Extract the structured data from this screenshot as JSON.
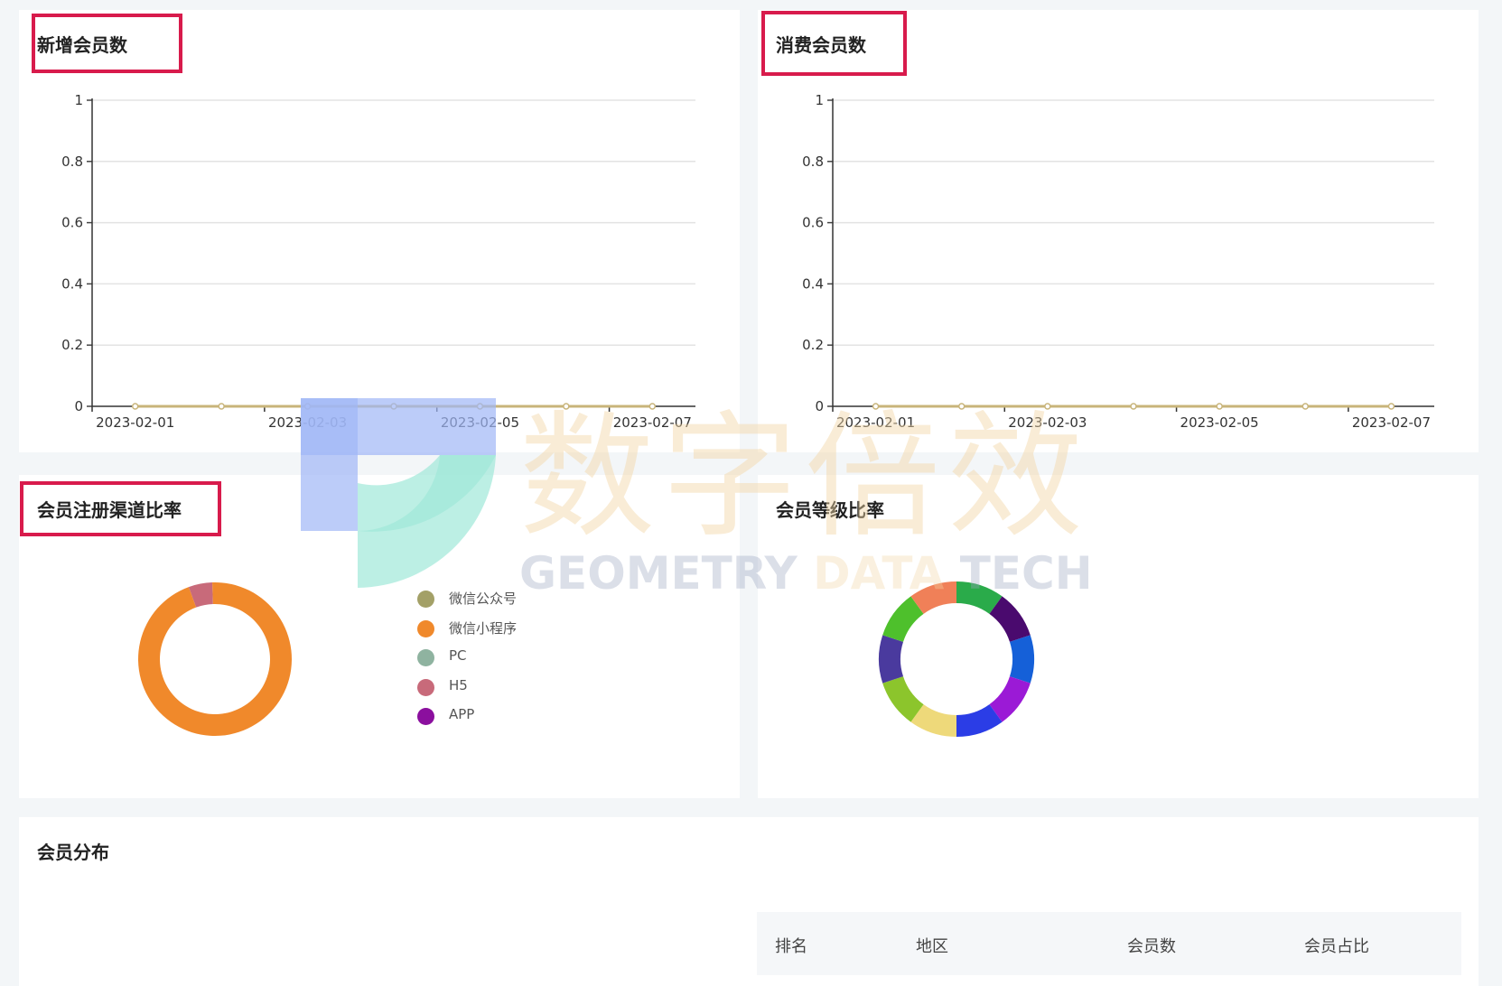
{
  "panels": {
    "new_members": {
      "title": "新增会员数"
    },
    "consume_members": {
      "title": "消费会员数"
    },
    "channel_ratio": {
      "title": "会员注册渠道比率"
    },
    "level_ratio": {
      "title": "会员等级比率"
    },
    "distribution": {
      "title": "会员分布"
    }
  },
  "table": {
    "headers": [
      "排名",
      "地区",
      "会员数",
      "会员占比"
    ]
  },
  "watermark": {
    "cn": "数字倍效",
    "en_a": "GEOMETRY ",
    "en_b": "DATA",
    "en_c": " TECH"
  },
  "chart_data": [
    {
      "type": "line",
      "x": [
        "2023-02-01",
        "2023-02-02",
        "2023-02-03",
        "2023-02-04",
        "2023-02-05",
        "2023-02-06",
        "2023-02-07"
      ],
      "x_tick_labels": [
        "2023-02-01",
        "2023-02-03",
        "2023-02-05",
        "2023-02-07"
      ],
      "series": [
        {
          "values": [
            0,
            0,
            0,
            0,
            0,
            0,
            0
          ],
          "color": "#c8b47a"
        }
      ],
      "ylim": [
        0,
        1
      ],
      "y_ticks": [
        "0",
        "0.2",
        "0.4",
        "0.6",
        "0.8",
        "1"
      ],
      "grid": true
    },
    {
      "type": "line",
      "x": [
        "2023-02-01",
        "2023-02-02",
        "2023-02-03",
        "2023-02-04",
        "2023-02-05",
        "2023-02-06",
        "2023-02-07"
      ],
      "x_tick_labels": [
        "2023-02-01",
        "2023-02-03",
        "2023-02-05",
        "2023-02-07"
      ],
      "series": [
        {
          "values": [
            0,
            0,
            0,
            0,
            0,
            0,
            0
          ],
          "color": "#c8b47a"
        }
      ],
      "ylim": [
        0,
        1
      ],
      "y_ticks": [
        "0",
        "0.2",
        "0.4",
        "0.6",
        "0.8",
        "1"
      ],
      "grid": true
    },
    {
      "type": "pie",
      "donut": true,
      "legend": [
        {
          "name": "微信公众号",
          "color": "#a3a067"
        },
        {
          "name": "微信小程序",
          "color": "#f0892b"
        },
        {
          "name": "PC",
          "color": "#8fb3a0"
        },
        {
          "name": "H5",
          "color": "#c86a7a"
        },
        {
          "name": "APP",
          "color": "#8b0f9e"
        }
      ],
      "values": [
        0,
        95,
        0,
        5,
        0
      ],
      "legend_position": "right"
    },
    {
      "type": "pie",
      "donut": true,
      "values": [
        10,
        10,
        10,
        10,
        10,
        10,
        10,
        10,
        10,
        10
      ],
      "colors": [
        "#2aab4a",
        "#4a0a6e",
        "#1560d8",
        "#9b1ad6",
        "#2b3de6",
        "#eed97a",
        "#8cc52c",
        "#4a3a9e",
        "#4ec02c",
        "#f08058"
      ]
    }
  ]
}
